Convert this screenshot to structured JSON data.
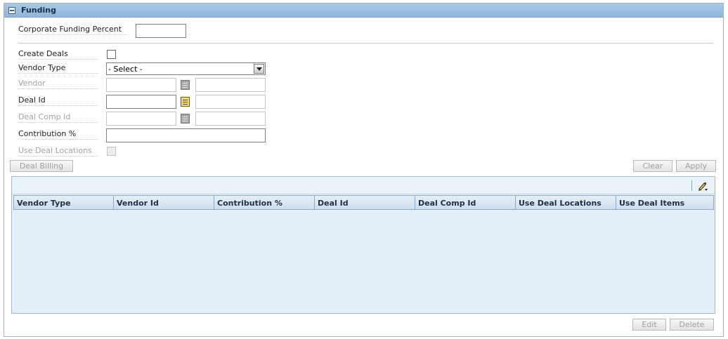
{
  "panel": {
    "title": "Funding"
  },
  "form": {
    "corporate_funding_percent": {
      "label": "Corporate Funding Percent",
      "value": ""
    },
    "create_deals": {
      "label": "Create Deals"
    },
    "vendor_type": {
      "label": "Vendor Type",
      "selected": "- Select -"
    },
    "vendor": {
      "label": "Vendor"
    },
    "deal_id": {
      "label": "Deal Id"
    },
    "deal_comp_id": {
      "label": "Deal Comp Id"
    },
    "contribution": {
      "label": "Contribution %"
    },
    "use_deal_locations": {
      "label": "Use Deal Locations"
    }
  },
  "buttons": {
    "deal_billing": "Deal Billing",
    "clear": "Clear",
    "apply": "Apply",
    "edit": "Edit",
    "delete": "Delete"
  },
  "table": {
    "columns": [
      "Vendor Type",
      "Vendor Id",
      "Contribution %",
      "Deal Id",
      "Deal Comp Id",
      "Use Deal Locations",
      "Use Deal Items"
    ],
    "rows": []
  },
  "icons": {
    "collapse": "minus-box-icon",
    "lookup": "list-lookup-icon",
    "edit_tool": "pencil-icon"
  },
  "colors": {
    "header_bg": "#99bde0",
    "grid_bg": "#e4eef7",
    "disabled_text": "#a3a3a3"
  }
}
